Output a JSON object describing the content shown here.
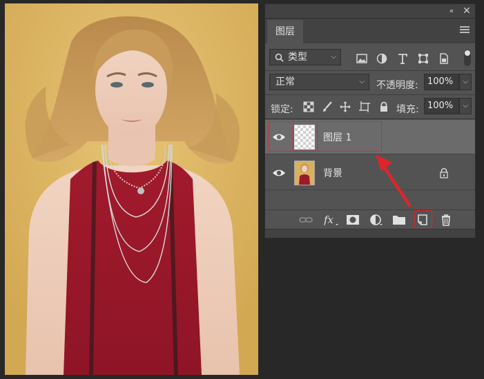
{
  "panel": {
    "tab_label": "图层",
    "filter": {
      "label": "类型",
      "icons": [
        "image-filter-icon",
        "adjustment-filter-icon",
        "type-filter-icon",
        "shape-filter-icon",
        "smart-object-filter-icon"
      ]
    },
    "blend_mode": "正常",
    "opacity_label": "不透明度:",
    "opacity_value": "100%",
    "lock_label": "锁定:",
    "fill_label": "填充:",
    "fill_value": "100%",
    "layers": [
      {
        "name": "图层 1",
        "selected": true,
        "visible": true,
        "thumbnail": "transparent"
      },
      {
        "name": "背景",
        "selected": false,
        "visible": true,
        "thumbnail": "photo",
        "locked": true
      }
    ],
    "bottom_icons": [
      "link-icon",
      "fx-icon",
      "mask-icon",
      "adjustment-layer-icon",
      "folder-icon",
      "new-layer-icon",
      "trash-icon"
    ]
  },
  "annotations": {
    "color": "#e0242b"
  }
}
